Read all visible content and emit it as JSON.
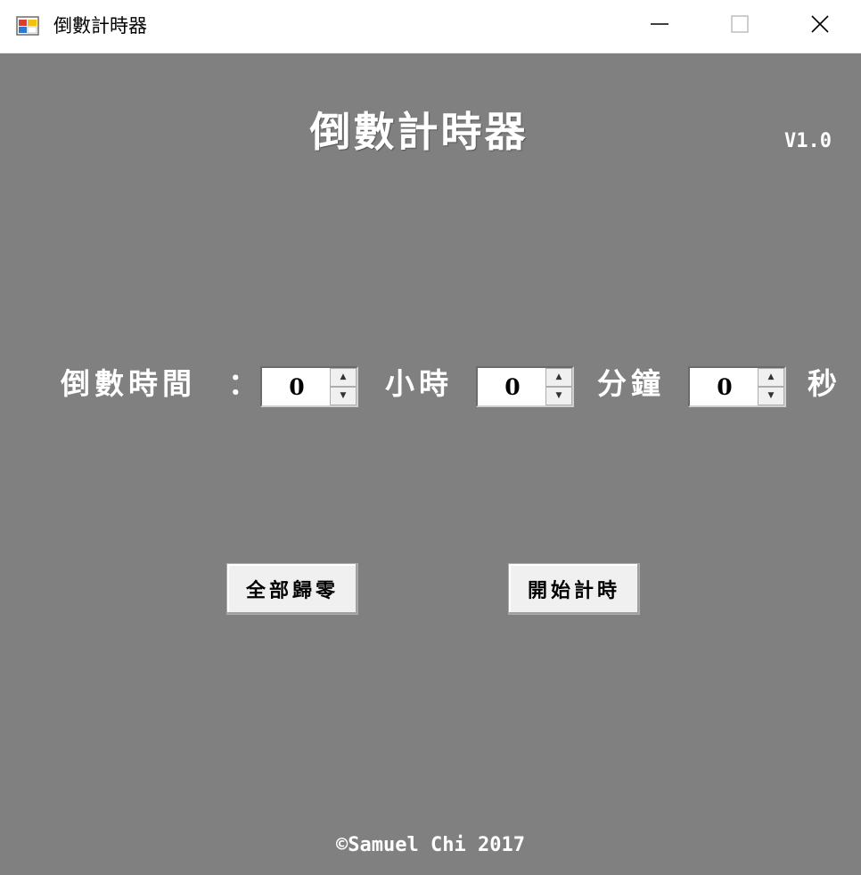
{
  "window": {
    "title": "倒數計時器",
    "app_icon": "winforms-app-icon",
    "controls": {
      "minimize_icon": "minimize-icon",
      "maximize_icon": "maximize-icon",
      "close_icon": "close-icon"
    }
  },
  "header": {
    "title": "倒數計時器",
    "version": "V1.0"
  },
  "timer": {
    "label": "倒數時間",
    "colon": "：",
    "hours": {
      "value": "0",
      "unit": "小時"
    },
    "minutes": {
      "value": "0",
      "unit": "分鐘"
    },
    "seconds": {
      "value": "0",
      "unit": "秒"
    },
    "spinner_up_icon": "spin-up-icon",
    "spinner_down_icon": "spin-down-icon"
  },
  "actions": {
    "reset_label": "全部歸零",
    "start_label": "開始計時"
  },
  "footer": {
    "copyright": "©Samuel Chi 2017"
  },
  "colors": {
    "background": "#808080",
    "titlebar": "#ffffff",
    "text": "#ffffff",
    "button_face": "#f0f0f0"
  }
}
